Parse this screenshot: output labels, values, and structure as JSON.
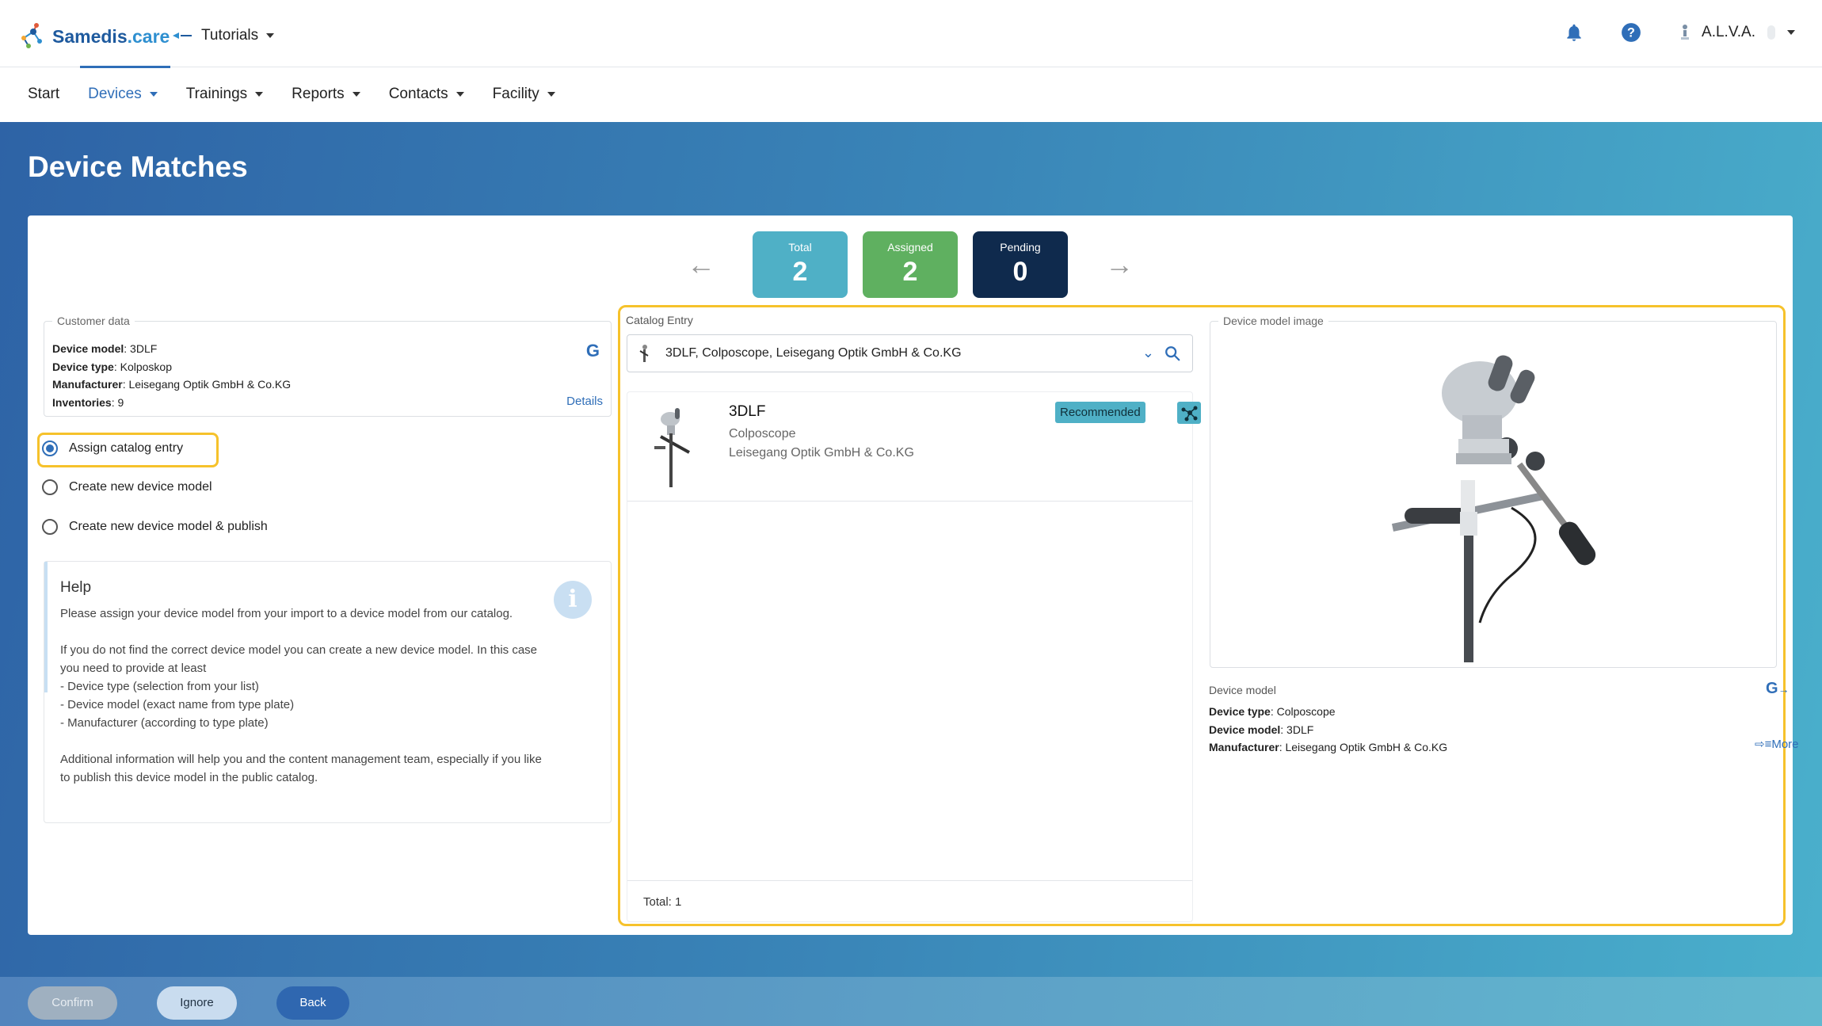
{
  "header": {
    "logo_text": "Samedis",
    "logo_suffix": ".care",
    "tenant": "Tutorials",
    "user": "A.L.V.A."
  },
  "nav": {
    "items": [
      {
        "label": "Start"
      },
      {
        "label": "Devices"
      },
      {
        "label": "Trainings"
      },
      {
        "label": "Reports"
      },
      {
        "label": "Contacts"
      },
      {
        "label": "Facility"
      }
    ]
  },
  "page": {
    "title": "Device Matches"
  },
  "counters": {
    "total_label": "Total",
    "total_value": "2",
    "assigned_label": "Assigned",
    "assigned_value": "2",
    "pending_label": "Pending",
    "pending_value": "0"
  },
  "customer": {
    "legend": "Customer data",
    "model_label": "Device model",
    "model_value": ": 3DLF",
    "type_label": "Device type",
    "type_value": ": Kolposkop",
    "manufacturer_label": "Manufacturer",
    "manufacturer_value": ": Leisegang Optik GmbH & Co.KG",
    "inventories_label": "Inventories",
    "inventories_value": ": 9",
    "google": "G",
    "details": "Details"
  },
  "options": {
    "assign": "Assign catalog entry",
    "create": "Create new device model",
    "create_publish": "Create new device model & publish"
  },
  "help": {
    "title": "Help",
    "text": "Please assign your device model from your import to a device model from our catalog.\n\nIf you do not find the correct device model you can create a new device model. In this case you need to provide at least\n- Device type (selection from your list)\n- Device model (exact name from type plate)\n- Manufacturer (according to type plate)\n\nAdditional information will help you and the content management team, especially if you like to publish this device model in the public catalog.",
    "icon": "i"
  },
  "catalog": {
    "label": "Catalog Entry",
    "value": "3DLF, Colposcope, Leisegang Optik GmbH & Co.KG",
    "result": {
      "name": "3DLF",
      "type": "Colposcope",
      "manufacturer": "Leisegang Optik GmbH & Co.KG",
      "badge": "Recommended"
    },
    "total": "Total: 1"
  },
  "device_model": {
    "image_legend": "Device model image",
    "label": "Device model",
    "google": "G",
    "type_label": "Device type",
    "type_value": ": Colposcope",
    "model_label": "Device model",
    "model_value": ": 3DLF",
    "manufacturer_label": "Manufacturer",
    "manufacturer_value": ": Leisegang Optik GmbH & Co.KG",
    "more": "More"
  },
  "actions": {
    "confirm": "Confirm",
    "ignore": "Ignore",
    "back": "Back"
  },
  "colors": {
    "accent": "#2f6eb8",
    "highlight": "#f6c22b",
    "teal": "#4fb0c6",
    "green": "#5fb060",
    "navy": "#0f2a4d"
  }
}
